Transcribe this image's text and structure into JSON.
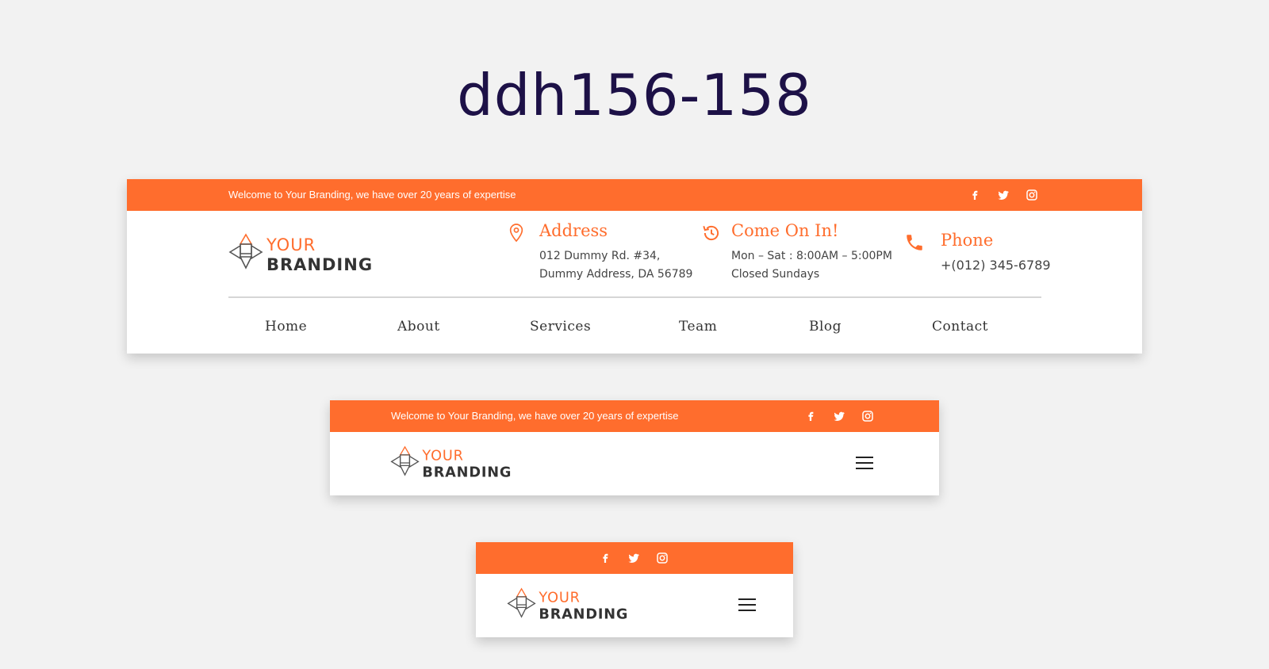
{
  "page": {
    "title": "ddh156-158"
  },
  "brand": {
    "line1": "YOUR",
    "line2": "BRANDING",
    "accent": "#ff6d2d"
  },
  "topbar": {
    "welcome": "Welcome to Your Branding, we have over 20 years of expertise",
    "social": [
      "facebook-icon",
      "twitter-icon",
      "instagram-icon"
    ]
  },
  "contact": {
    "address": {
      "title": "Address",
      "line1": "012 Dummy Rd. #34,",
      "line2": "Dummy Address, DA 56789",
      "icon": "map-pin-icon"
    },
    "hours": {
      "title": "Come On In!",
      "line1": "Mon – Sat : 8:00AM – 5:00PM",
      "line2": "Closed Sundays",
      "icon": "history-clock-icon"
    },
    "phone": {
      "title": "Phone",
      "line1": "+(012) 345-6789",
      "icon": "phone-icon"
    }
  },
  "nav": {
    "items": [
      "Home",
      "About",
      "Services",
      "Team",
      "Blog",
      "Contact"
    ]
  },
  "colors": {
    "orange": "#ff6d2d",
    "title": "#1d1147",
    "background": "#f2f2f2"
  }
}
